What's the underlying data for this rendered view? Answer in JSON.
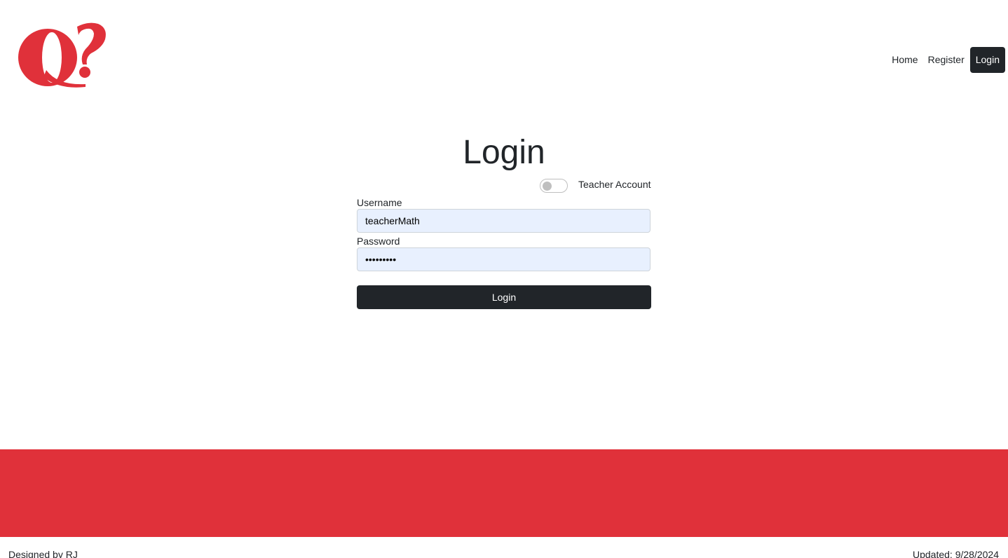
{
  "brand": {
    "logo_text": "Q?",
    "accent_color": "#e0313a"
  },
  "nav": {
    "items": [
      {
        "label": "Home"
      },
      {
        "label": "Register"
      },
      {
        "label": "Login"
      }
    ],
    "active": "Login"
  },
  "page": {
    "title": "Login"
  },
  "form": {
    "teacher_toggle_label": "Teacher Account",
    "teacher_toggle_on": false,
    "username_label": "Username",
    "username_value": "teacherMath",
    "password_label": "Password",
    "password_value": "•••••••••",
    "submit_label": "Login"
  },
  "footer": {
    "left_text": "Designed by RJ",
    "right_text": "Updated: 9/28/2024"
  }
}
